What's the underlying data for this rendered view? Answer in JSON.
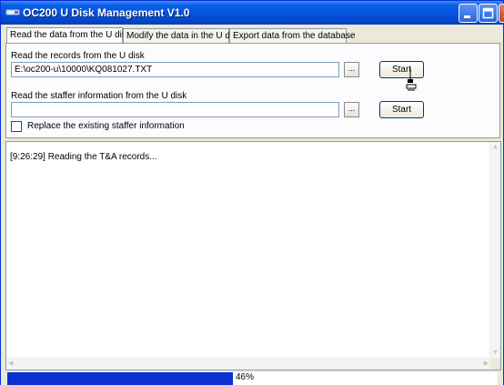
{
  "window": {
    "title": "OC200 U Disk Management V1.0",
    "accent_color": "#0554e3",
    "controls": [
      "minimize-icon",
      "maximize-icon",
      "close-icon"
    ]
  },
  "tabs": [
    {
      "label": "Read the data from the U disk",
      "active": true
    },
    {
      "label": "Modify the data in the U disk",
      "active": false
    },
    {
      "label": "Export data from the database",
      "active": false
    }
  ],
  "records": {
    "label": "Read the records from the U disk",
    "path": "E:\\oc200-u\\10000\\KQ081027.TXT",
    "browse_label": "...",
    "start_label": "Start"
  },
  "staffer": {
    "label": "Read the staffer information from the U disk",
    "path": "",
    "browse_label": "...",
    "start_label": "Start",
    "replace_label": "Replace the existing staffer information",
    "replace_checked": false
  },
  "log": {
    "lines": [
      "[9:26:29] Reading the T&A records..."
    ]
  },
  "status": {
    "progress_percent": 46,
    "progress_text": "46%",
    "progress_color": "#0b2fd1"
  }
}
